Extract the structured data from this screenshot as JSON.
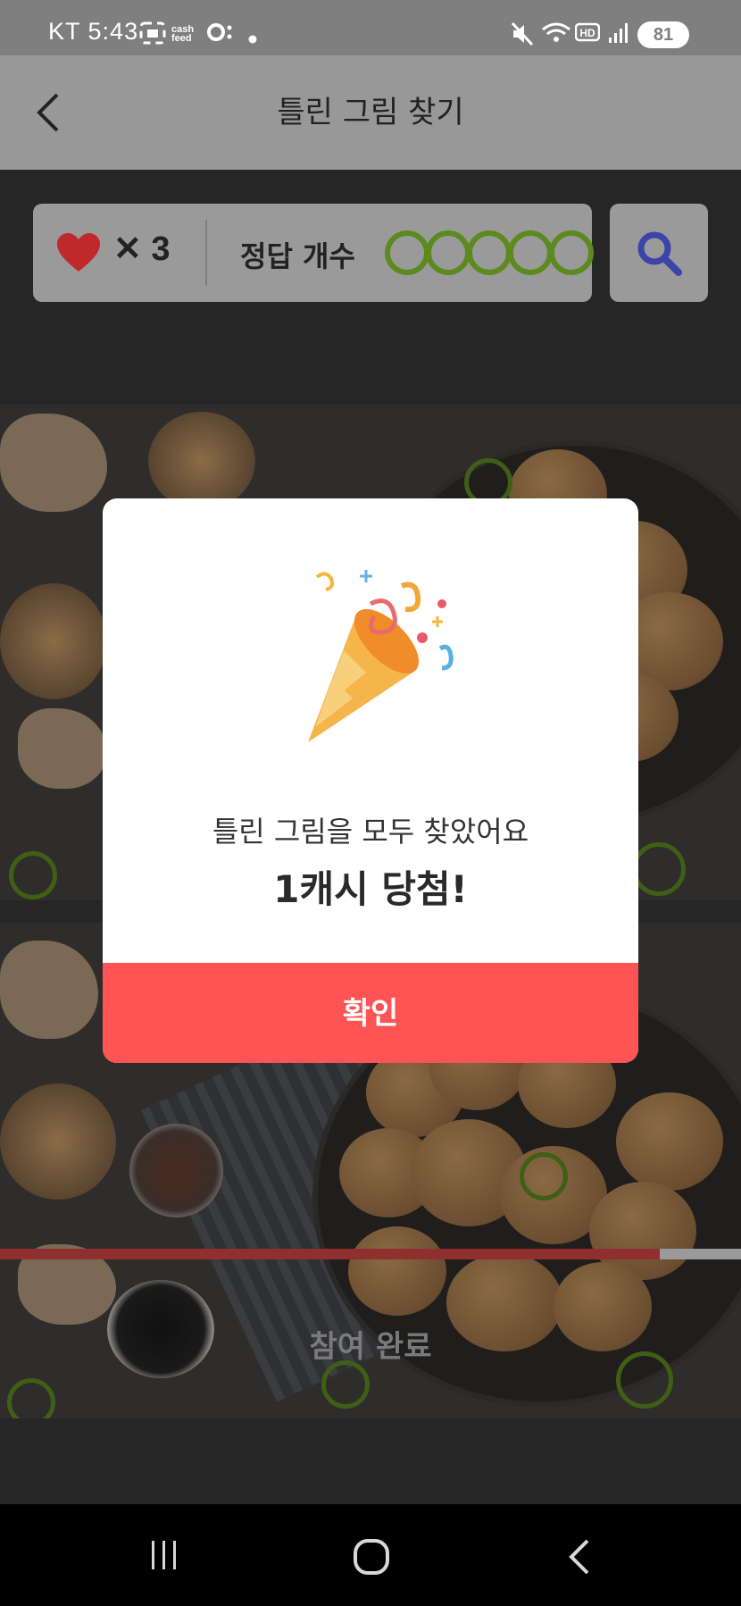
{
  "status_bar": {
    "carrier": "KT",
    "time": "5:43",
    "app_badge": "cash feed",
    "battery": "81",
    "icons": [
      "screenshot-icon",
      "cashfeed-icon",
      "circle-dot-icon",
      "dot-icon",
      "mute-icon",
      "wifi-icon",
      "hd-icon",
      "signal-icon",
      "battery-icon"
    ]
  },
  "header": {
    "title": "틀린 그림 찾기",
    "back_icon": "chevron-left-icon"
  },
  "info_bar": {
    "lives_icon": "heart-icon",
    "lives_text": "✕ 3",
    "answer_label": "정답 개수",
    "answer_total": 5,
    "answer_found": 5,
    "search_icon": "search-icon",
    "colors": {
      "heart": "#c0282a",
      "slot": "#5c8a1e",
      "search": "#3b44a8"
    }
  },
  "game": {
    "done_label": "참여 완료",
    "progress_fraction": 0.89,
    "progress_color": "#8f2f2e"
  },
  "modal": {
    "icon": "party-popper-icon",
    "message": "틀린 그림을 모두 찾았어요",
    "reward": "1캐시 당첨!",
    "confirm_label": "확인",
    "confirm_color": "#ff5454"
  },
  "nav_bar": {
    "items": [
      "recent-apps-icon",
      "home-icon",
      "back-icon"
    ]
  }
}
